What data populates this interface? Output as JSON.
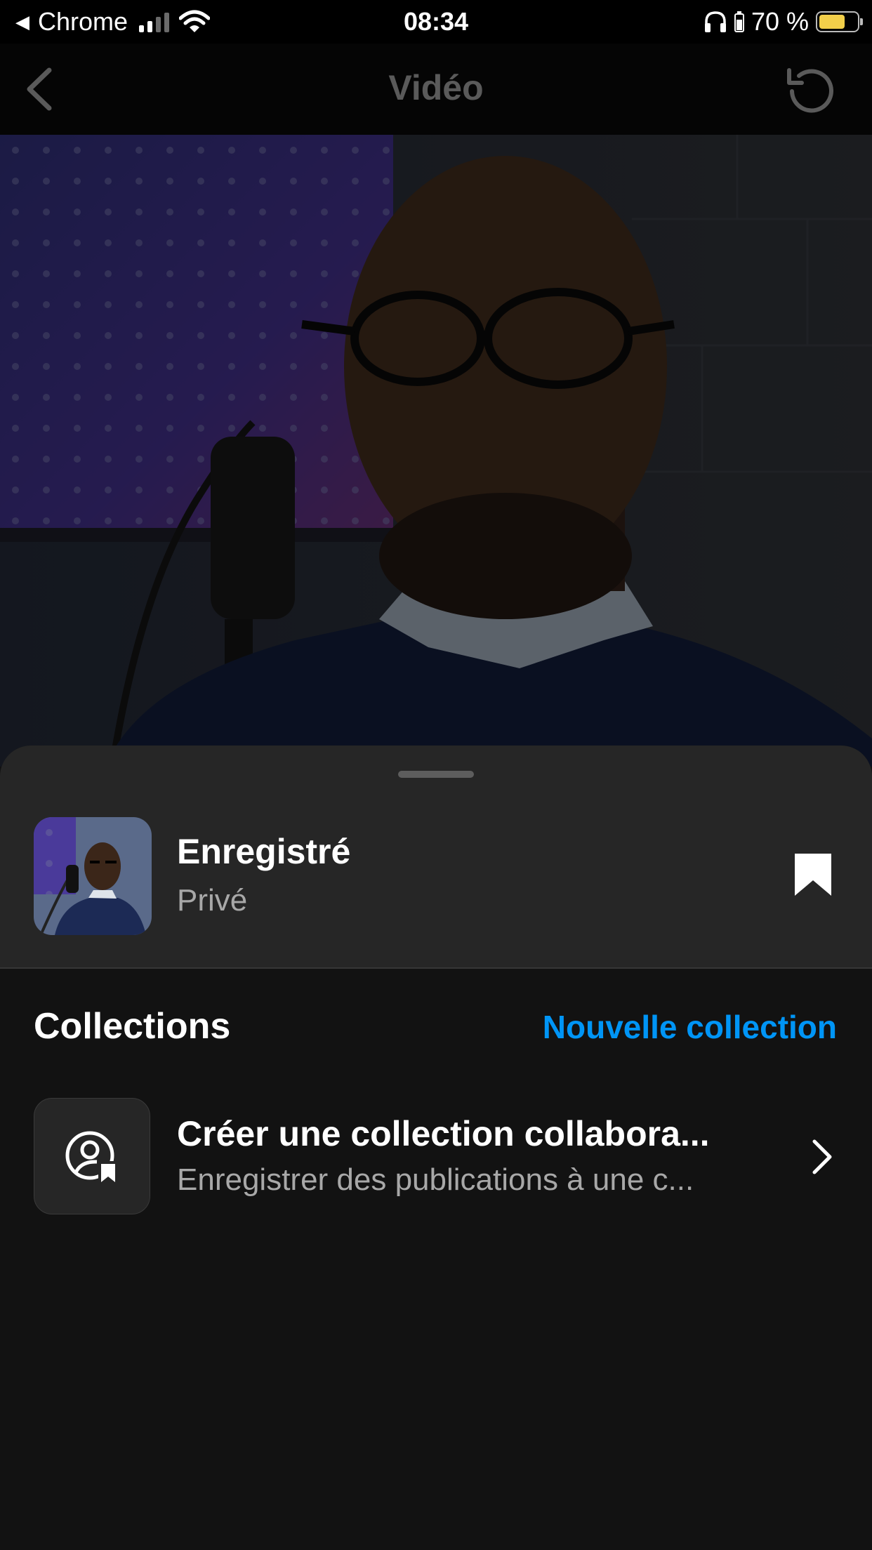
{
  "status_bar": {
    "back_app": "Chrome",
    "time": "08:34",
    "battery_percent": "70 %",
    "battery_level": 0.7,
    "battery_color": "#f2cf4a"
  },
  "nav": {
    "title": "Vidéo",
    "back_icon": "chevron-left-icon",
    "action_icon": "refresh-icon"
  },
  "saved": {
    "title": "Enregistré",
    "subtitle": "Privé",
    "bookmark_icon": "bookmark-filled-icon"
  },
  "collections": {
    "heading": "Collections",
    "new_collection": "Nouvelle collection",
    "accent_color": "#0095f6"
  },
  "collab_row": {
    "title": "Créer une collection collabora...",
    "subtitle": "Enregistrer des publications à une c...",
    "icon": "person-bookmark-icon",
    "chevron_icon": "chevron-right-icon"
  }
}
